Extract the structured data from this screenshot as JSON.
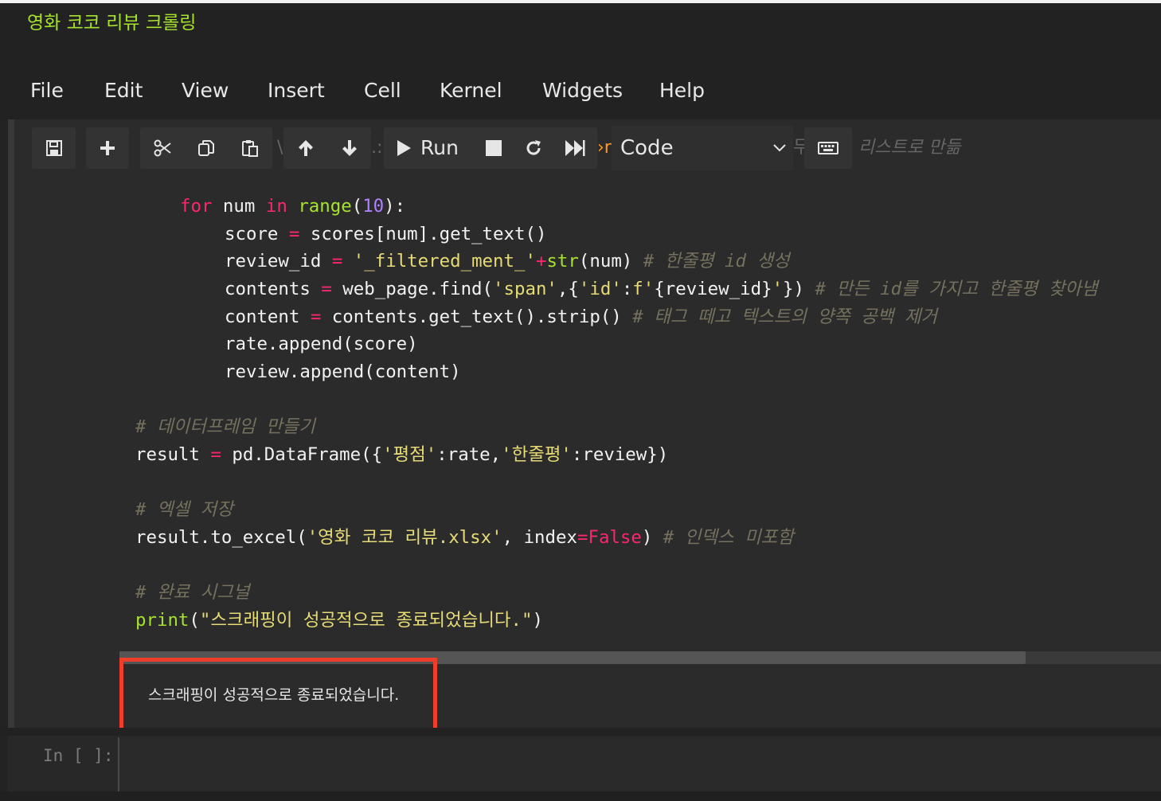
{
  "notebook": {
    "title": "영화 코코 리뷰 크롤링"
  },
  "menu": [
    "File",
    "Edit",
    "View",
    "Insert",
    "Cell",
    "Kernel",
    "Widgets",
    "Help"
  ],
  "toolbar": {
    "run_label": "Run",
    "cell_type": "Code",
    "peek_text": "리스트로 만듦",
    "icons": [
      "save-icon",
      "plus-icon",
      "scissors-icon",
      "copy-icon",
      "paste-icon",
      "arrow-up-icon",
      "arrow-down-icon",
      "play-icon",
      "stop-icon",
      "restart-icon",
      "fast-forward-icon",
      "chevron-down-icon",
      "keyboard-icon"
    ]
  },
  "code": {
    "l1": {
      "kw1": "for",
      "a": " num ",
      "kw2": "in",
      "sp": " ",
      "fn": "range",
      "b": "(",
      "num": "10",
      "c": "):"
    },
    "l2": {
      "a": "score ",
      "op": "=",
      "b": " scores[num].get_text()"
    },
    "l3": {
      "a": "review_id ",
      "op": "=",
      "b": " ",
      "str": "'_filtered_ment_'",
      "plus": "+",
      "fn": "str",
      "c": "(num) ",
      "cmt": "# 한줄평 id 생성"
    },
    "l4": {
      "a": "contents ",
      "op": "=",
      "b": " web_page.find(",
      "s1": "'span'",
      "c": ",{",
      "s2": "'id'",
      "d": ":",
      "s3": "f'",
      "e": "{review_id}",
      "s4": "'",
      "f": "}) ",
      "cmt": "# 만든 id를 가지고 한줄평 찾아냄"
    },
    "l5": {
      "a": "content ",
      "op": "=",
      "b": " contents.get_text().strip() ",
      "cmt": "# 태그 떼고 텍스트의 양쪽 공백 제거"
    },
    "l6": {
      "a": "rate.append(score)"
    },
    "l7": {
      "a": "review.append(content)"
    },
    "l8": {
      "cmt": "# 데이터프레임 만들기"
    },
    "l9": {
      "a": "result ",
      "op": "=",
      "b": " pd.DataFrame({",
      "s1": "'평점'",
      "c": ":rate,",
      "s2": "'한줄평'",
      "d": ":review})"
    },
    "l10": {
      "cmt": "# 엑셀 저장"
    },
    "l11": {
      "a": "result.to_excel(",
      "s1": "'영화 코코 리뷰.xlsx'",
      "b": ", index",
      "op": "=",
      "bool": "False",
      "c": ") ",
      "cmt": "# 인덱스 미포함"
    },
    "l12": {
      "cmt": "# 완료 시그널"
    },
    "l13": {
      "fn": "print",
      "a": "(",
      "s1": "\"스크래핑이 성공적으로 종료되었습니다.\"",
      "b": ")"
    }
  },
  "output": {
    "text": "스크래핑이 성공적으로 종료되었습니다."
  },
  "next_cell": {
    "prompt": "In [ ]:"
  },
  "colors": {
    "accent_title": "#a6e22e",
    "highlight_box": "#ef3e2a",
    "background": "#2b2b2b"
  }
}
